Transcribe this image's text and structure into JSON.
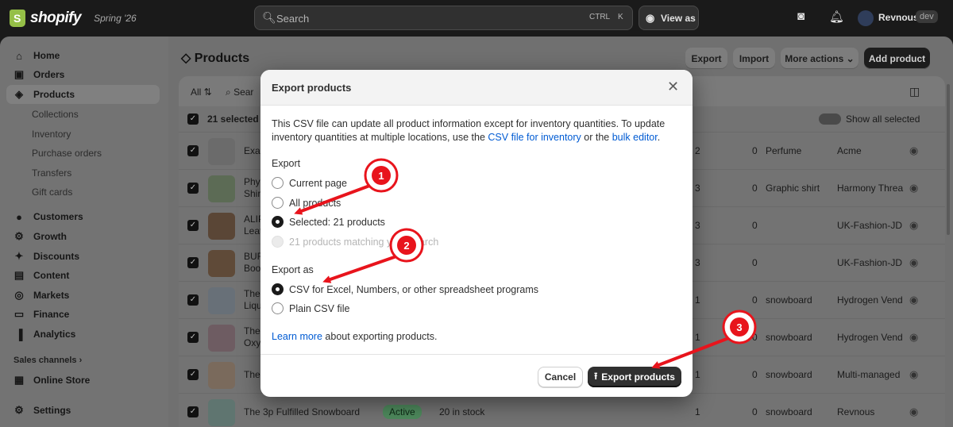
{
  "topbar": {
    "brand": "shopify",
    "edition": "Spring '26",
    "search_placeholder": "Search",
    "shortcut_ctrl": "CTRL",
    "shortcut_k": "K",
    "view_as": "View as",
    "user": "Revnous",
    "user_badge": "dev"
  },
  "sidebar": {
    "items": [
      {
        "label": "Home",
        "icon": "home-icon"
      },
      {
        "label": "Orders",
        "icon": "orders-icon"
      },
      {
        "label": "Products",
        "icon": "tag-icon"
      },
      {
        "label": "Customers",
        "icon": "person-icon"
      },
      {
        "label": "Growth",
        "icon": "growth-icon"
      },
      {
        "label": "Discounts",
        "icon": "discount-icon"
      },
      {
        "label": "Content",
        "icon": "content-icon"
      },
      {
        "label": "Markets",
        "icon": "globe-icon"
      },
      {
        "label": "Finance",
        "icon": "finance-icon"
      },
      {
        "label": "Analytics",
        "icon": "analytics-icon"
      },
      {
        "label": "Online Store",
        "icon": "store-icon"
      },
      {
        "label": "Settings",
        "icon": "gear-icon"
      }
    ],
    "sub_items": [
      "Collections",
      "Inventory",
      "Purchase orders",
      "Transfers",
      "Gift cards"
    ],
    "sales_channels_heading": "Sales channels"
  },
  "page": {
    "title": "Products",
    "buttons": {
      "export": "Export",
      "import": "Import",
      "more_actions": "More actions",
      "add_product": "Add product"
    }
  },
  "list": {
    "filter_all": "All",
    "search_stub": "Sear",
    "selected_count": "21 selected",
    "show_all_selected": "Show all selected",
    "rows": [
      {
        "title": "Exa",
        "c1": "2",
        "c2": "0",
        "type": "Perfume",
        "vendor": "Acme"
      },
      {
        "title": "Phy",
        "title2": "Shir",
        "c1": "3",
        "c2": "0",
        "type": "Graphic shirt",
        "vendor": "Harmony Threa"
      },
      {
        "title": "ALIP",
        "title2": "Leat",
        "c1": "3",
        "c2": "0",
        "type": "",
        "vendor": "UK-Fashion-JD"
      },
      {
        "title": "BUR",
        "title2": "Boo",
        "c1": "3",
        "c2": "0",
        "type": "",
        "vendor": "UK-Fashion-JD"
      },
      {
        "title": "The",
        "title2": "Liqu",
        "c1": "1",
        "c2": "0",
        "type": "snowboard",
        "vendor": "Hydrogen Vend"
      },
      {
        "title": "The",
        "title2": "Oxy",
        "c1": "1",
        "c2": "0",
        "type": "snowboard",
        "vendor": "Hydrogen Vend"
      },
      {
        "title": "The",
        "c1": "1",
        "c2": "0",
        "type": "snowboard",
        "vendor": "Multi-managed"
      },
      {
        "title": "The 3p Fulfilled Snowboard",
        "status": "Active",
        "inventory": "20 in stock",
        "c1": "1",
        "c2": "0",
        "type": "snowboard",
        "vendor": "Revnous"
      }
    ]
  },
  "modal": {
    "title": "Export products",
    "description_1": "This CSV file can update all product information except for inventory quantities. To update inventory quantities at multiple locations, use the ",
    "link_csv_inventory": "CSV file for inventory",
    "description_2": " or the ",
    "link_bulk_editor": "bulk editor",
    "description_3": ".",
    "export_label": "Export",
    "export_options": [
      "Current page",
      "All products",
      "Selected: 21 products",
      "21 products matching your search"
    ],
    "export_as_label": "Export as",
    "format_options": [
      "CSV for Excel, Numbers, or other spreadsheet programs",
      "Plain CSV file"
    ],
    "learn_more": "Learn more",
    "learn_more_suffix": " about exporting products.",
    "cancel": "Cancel",
    "export_button": "Export products"
  },
  "annotations": [
    "1",
    "2",
    "3"
  ],
  "colors": {
    "annotation_red": "#e8141c",
    "link_blue": "#005bd3",
    "brand_green": "#95bf47"
  }
}
